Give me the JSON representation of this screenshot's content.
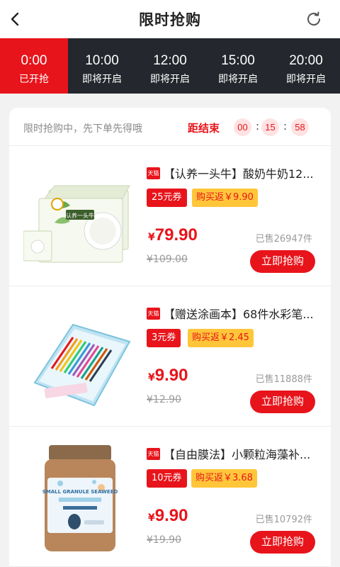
{
  "header": {
    "title": "限时抢购"
  },
  "time_slots": [
    {
      "time": "0:00",
      "status": "已开抢",
      "active": true
    },
    {
      "time": "10:00",
      "status": "即将开启",
      "active": false
    },
    {
      "time": "12:00",
      "status": "即将开启",
      "active": false
    },
    {
      "time": "15:00",
      "status": "即将开启",
      "active": false
    },
    {
      "time": "20:00",
      "status": "即将开启",
      "active": false
    }
  ],
  "countdown": {
    "hint": "限时抢购中，先下单先得哦",
    "label": "距结束",
    "hours": "00",
    "minutes": "15",
    "seconds": "58",
    "separator": ":"
  },
  "products": [
    {
      "mall_badge": "天猫",
      "name": "【认养一头牛】酸奶牛奶12...",
      "coupon": "25元券",
      "rebate": "购买返￥9.90",
      "currency": "¥",
      "price": "79.90",
      "original_price": "¥109.00",
      "sold": "已售26947件",
      "buy_label": "立即抢购"
    },
    {
      "mall_badge": "天猫",
      "name": "【赠送涂画本】68件水彩笔...",
      "coupon": "3元券",
      "rebate": "购买返￥2.45",
      "currency": "¥",
      "price": "9.90",
      "original_price": "¥12.90",
      "sold": "已售11888件",
      "buy_label": "立即抢购"
    },
    {
      "mall_badge": "天猫",
      "name": "【自由膜法】小颗粒海藻补...",
      "coupon": "10元券",
      "rebate": "购买返￥3.68",
      "currency": "¥",
      "price": "9.90",
      "original_price": "¥19.90",
      "sold": "已售10792件",
      "buy_label": "立即抢购"
    }
  ],
  "product_images": [
    {
      "icon": "milk-carton-product-image",
      "text": "认养一头牛"
    },
    {
      "icon": "watercolor-pen-set-product-image",
      "text": ""
    },
    {
      "icon": "seaweed-mask-jar-product-image",
      "text": "SMALL GRANULE SEAWEED"
    }
  ],
  "colors": {
    "accent": "#e8141b",
    "timebar_bg": "#24272d",
    "rebate_bg": "#ffc63a"
  }
}
